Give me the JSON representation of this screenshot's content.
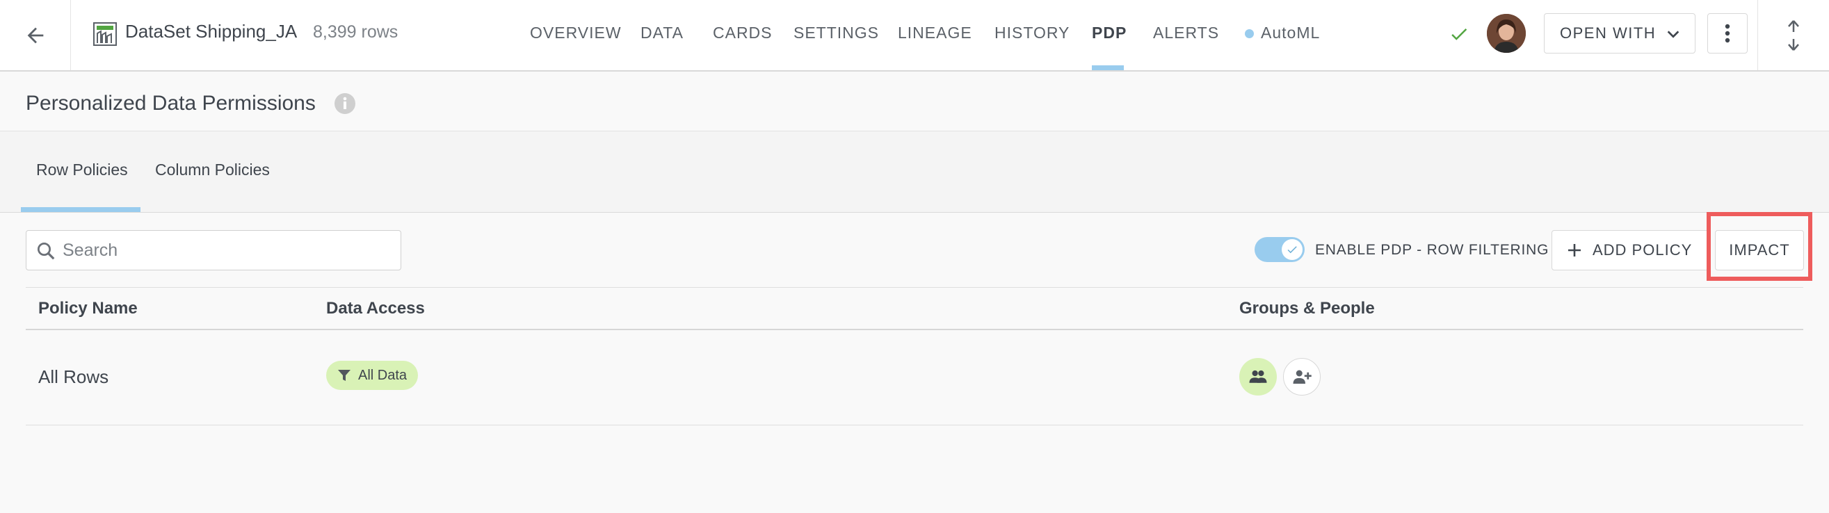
{
  "header": {
    "dataset_name": "DataSet Shipping_JA",
    "row_count": "8,399 rows",
    "tabs": [
      {
        "label": "OVERVIEW"
      },
      {
        "label": "DATA"
      },
      {
        "label": "CARDS"
      },
      {
        "label": "SETTINGS"
      },
      {
        "label": "LINEAGE"
      },
      {
        "label": "HISTORY"
      },
      {
        "label": "PDP"
      },
      {
        "label": "ALERTS"
      },
      {
        "label": "AutoML"
      }
    ],
    "active_tab": "PDP",
    "open_with_label": "OPEN WITH"
  },
  "page": {
    "title": "Personalized Data Permissions"
  },
  "subtabs": [
    {
      "label": "Row Policies"
    },
    {
      "label": "Column Policies"
    }
  ],
  "active_subtab": "Row Policies",
  "toolbar": {
    "search_placeholder": "Search",
    "toggle_label": "ENABLE PDP - ROW FILTERING",
    "toggle_on": true,
    "add_policy_label": "ADD POLICY",
    "impact_label": "IMPACT"
  },
  "table": {
    "columns": [
      "Policy Name",
      "Data Access",
      "Groups & People"
    ],
    "rows": [
      {
        "policy_name": "All Rows",
        "data_access": "All Data"
      }
    ]
  },
  "colors": {
    "accent": "#99ccee",
    "chip_bg": "#d9f2b6",
    "highlight": "#ee5c5c",
    "success": "#52a541"
  },
  "icons": {
    "back": "arrow-left-icon",
    "dataset": "dataset-grid-icon",
    "info": "info-icon",
    "status": "check-icon",
    "more": "kebab-icon",
    "expand": "expand-vertical-icon",
    "search": "search-icon",
    "add": "plus-icon",
    "filter": "filter-icon",
    "group": "group-icon",
    "add_person": "person-add-icon"
  }
}
